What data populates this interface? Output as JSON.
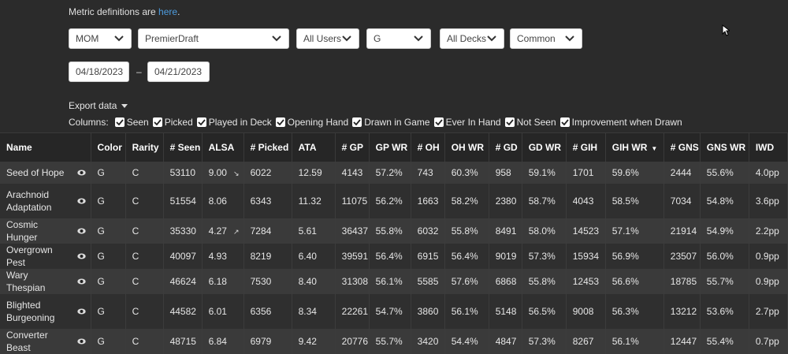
{
  "defs": {
    "text": "Metric definitions are ",
    "link": "here",
    "end": "."
  },
  "filters": [
    {
      "name": "set-select",
      "value": "MOM"
    },
    {
      "name": "format-select",
      "value": "PremierDraft"
    },
    {
      "name": "users-select",
      "value": "All Users"
    },
    {
      "name": "color-select",
      "value": "G"
    },
    {
      "name": "decks-select",
      "value": "All Decks"
    },
    {
      "name": "rarity-select",
      "value": "Common"
    }
  ],
  "dates": {
    "start": "04/18/2023",
    "sep": "–",
    "end": "04/21/2023"
  },
  "export_label": "Export data",
  "columns_label": "Columns:",
  "column_toggles": [
    "Seen",
    "Picked",
    "Played in Deck",
    "Opening Hand",
    "Drawn in Game",
    "Ever In Hand",
    "Not Seen",
    "Improvement when Drawn"
  ],
  "headers": [
    "Name",
    "Color",
    "Rarity",
    "# Seen",
    "ALSA",
    "# Picked",
    "ATA",
    "# GP",
    "GP WR",
    "# OH",
    "OH WR",
    "# GD",
    "GD WR",
    "# GIH",
    "GIH WR",
    "# GNS",
    "GNS WR",
    "IWD"
  ],
  "rows": [
    {
      "name": "Seed of Hope",
      "cells": [
        "G",
        "C",
        "53110",
        "9.00",
        "6022",
        "12.59",
        "4143",
        "57.2%",
        "743",
        "60.3%",
        "958",
        "59.1%",
        "1701",
        "59.6%",
        "2444",
        "55.6%",
        "4.0pp"
      ],
      "alsa_arrow": "↘",
      "tall": false
    },
    {
      "name": "Arachnoid Adaptation",
      "cells": [
        "G",
        "C",
        "51554",
        "8.06",
        "6343",
        "11.32",
        "11075",
        "56.2%",
        "1663",
        "58.2%",
        "2380",
        "58.7%",
        "4043",
        "58.5%",
        "7034",
        "54.8%",
        "3.6pp"
      ],
      "alsa_arrow": "",
      "tall": true
    },
    {
      "name": "Cosmic Hunger",
      "cells": [
        "G",
        "C",
        "35330",
        "4.27",
        "7284",
        "5.61",
        "36437",
        "55.8%",
        "6032",
        "55.8%",
        "8491",
        "58.0%",
        "14523",
        "57.1%",
        "21914",
        "54.9%",
        "2.2pp"
      ],
      "alsa_arrow": "↗",
      "tall": false
    },
    {
      "name": "Overgrown Pest",
      "cells": [
        "G",
        "C",
        "40097",
        "4.93",
        "8219",
        "6.40",
        "39591",
        "56.4%",
        "6915",
        "56.4%",
        "9019",
        "57.3%",
        "15934",
        "56.9%",
        "23507",
        "56.0%",
        "0.9pp"
      ],
      "alsa_arrow": "",
      "tall": false
    },
    {
      "name": "Wary Thespian",
      "cells": [
        "G",
        "C",
        "46624",
        "6.18",
        "7530",
        "8.40",
        "31308",
        "56.1%",
        "5585",
        "57.6%",
        "6868",
        "55.8%",
        "12453",
        "56.6%",
        "18785",
        "55.7%",
        "0.9pp"
      ],
      "alsa_arrow": "",
      "tall": false
    },
    {
      "name": "Blighted Burgeoning",
      "cells": [
        "G",
        "C",
        "44582",
        "6.01",
        "6356",
        "8.34",
        "22261",
        "54.7%",
        "3860",
        "56.1%",
        "5148",
        "56.5%",
        "9008",
        "56.3%",
        "13212",
        "53.6%",
        "2.7pp"
      ],
      "alsa_arrow": "",
      "tall": true
    },
    {
      "name": "Converter Beast",
      "cells": [
        "G",
        "C",
        "48715",
        "6.84",
        "6979",
        "9.42",
        "20776",
        "55.7%",
        "3420",
        "54.4%",
        "4847",
        "57.3%",
        "8267",
        "56.1%",
        "12447",
        "55.4%",
        "0.7pp"
      ],
      "alsa_arrow": "",
      "tall": false
    }
  ]
}
